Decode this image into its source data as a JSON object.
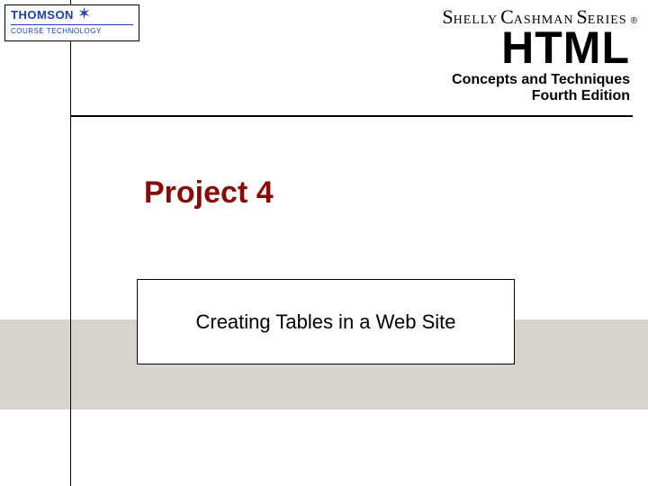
{
  "publisher": {
    "brand": "THOMSON",
    "division": "COURSE TECHNOLOGY"
  },
  "series": {
    "s_cap": "S",
    "s_rest": "HELLY",
    "c_cap": "C",
    "c_rest": "ASHMAN",
    "r_cap": "S",
    "r_rest": "ERIES",
    "reg": "®"
  },
  "title": {
    "main": "HTML",
    "subtitle": "Concepts and Techniques",
    "edition": "Fourth Edition"
  },
  "project": {
    "label": "Project 4"
  },
  "subtitle_box": {
    "text": "Creating Tables in a Web Site"
  }
}
